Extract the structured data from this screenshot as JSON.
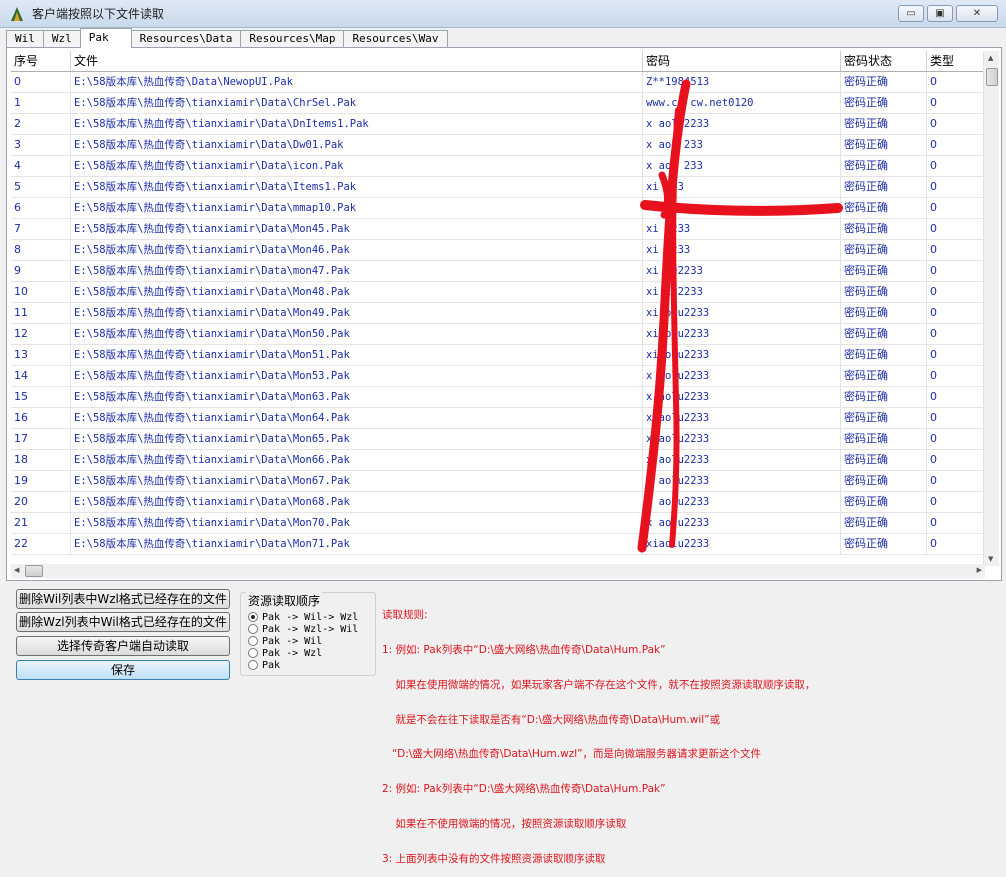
{
  "window": {
    "title": "客户端按照以下文件读取",
    "minimize_glyph": "▭",
    "maximize_glyph": "▣",
    "close_glyph": "✕"
  },
  "tabs": [
    {
      "label": "Wil"
    },
    {
      "label": "Wzl"
    },
    {
      "label": "Pak"
    },
    {
      "label": "Resources\\Data"
    },
    {
      "label": "Resources\\Map"
    },
    {
      "label": "Resources\\Wav"
    }
  ],
  "table": {
    "columns": {
      "index": "序号",
      "file": "文件",
      "password": "密码",
      "status": "密码状态",
      "type": "类型"
    },
    "rows": [
      {
        "index": "0",
        "file": "E:\\58版本库\\热血传奇\\Data\\NewopUI.Pak",
        "password": "Z**1984513",
        "status": "密码正确",
        "type": "0"
      },
      {
        "index": "1",
        "file": "E:\\58版本库\\热血传奇\\tianxiamir\\Data\\ChrSel.Pak",
        "password": "www.cc  cw.net0120",
        "status": "密码正确",
        "type": "0"
      },
      {
        "index": "2",
        "file": "E:\\58版本库\\热血传奇\\tianxiamir\\Data\\DnItems1.Pak",
        "password": "x  aolu2233",
        "status": "密码正确",
        "type": "0"
      },
      {
        "index": "3",
        "file": "E:\\58版本库\\热血传奇\\tianxiamir\\Data\\Dw01.Pak",
        "password": "x  aol  233",
        "status": "密码正确",
        "type": "0"
      },
      {
        "index": "4",
        "file": "E:\\58版本库\\热血传奇\\tianxiamir\\Data\\icon.Pak",
        "password": "x  aol  233",
        "status": "密码正确",
        "type": "0"
      },
      {
        "index": "5",
        "file": "E:\\58版本库\\热血传奇\\tianxiamir\\Data\\Items1.Pak",
        "password": "xi    233",
        "status": "密码正确",
        "type": "0"
      },
      {
        "index": "6",
        "file": "E:\\58版本库\\热血传奇\\tianxiamir\\Data\\mmap10.Pak",
        "password": "",
        "status": "密码正确",
        "type": "0"
      },
      {
        "index": "7",
        "file": "E:\\58版本库\\热血传奇\\tianxiamir\\Data\\Mon45.Pak",
        "password": "xi    2233",
        "status": "密码正确",
        "type": "0"
      },
      {
        "index": "8",
        "file": "E:\\58版本库\\热血传奇\\tianxiamir\\Data\\Mon46.Pak",
        "password": "xi    2233",
        "status": "密码正确",
        "type": "0"
      },
      {
        "index": "9",
        "file": "E:\\58版本库\\热血传奇\\tianxiamir\\Data\\mon47.Pak",
        "password": "xi   lu2233",
        "status": "密码正确",
        "type": "0"
      },
      {
        "index": "10",
        "file": "E:\\58版本库\\热血传奇\\tianxiamir\\Data\\Mon48.Pak",
        "password": "xi  lu2233",
        "status": "密码正确",
        "type": "0"
      },
      {
        "index": "11",
        "file": "E:\\58版本库\\热血传奇\\tianxiamir\\Data\\Mon49.Pak",
        "password": "xi  olu2233",
        "status": "密码正确",
        "type": "0"
      },
      {
        "index": "12",
        "file": "E:\\58版本库\\热血传奇\\tianxiamir\\Data\\Mon50.Pak",
        "password": "xi  olu2233",
        "status": "密码正确",
        "type": "0"
      },
      {
        "index": "13",
        "file": "E:\\58版本库\\热血传奇\\tianxiamir\\Data\\Mon51.Pak",
        "password": "xi  olu2233",
        "status": "密码正确",
        "type": "0"
      },
      {
        "index": "14",
        "file": "E:\\58版本库\\热血传奇\\tianxiamir\\Data\\Mon53.Pak",
        "password": "x  aolu2233",
        "status": "密码正确",
        "type": "0"
      },
      {
        "index": "15",
        "file": "E:\\58版本库\\热血传奇\\tianxiamir\\Data\\Mon63.Pak",
        "password": "x  aolu2233",
        "status": "密码正确",
        "type": "0"
      },
      {
        "index": "16",
        "file": "E:\\58版本库\\热血传奇\\tianxiamir\\Data\\Mon64.Pak",
        "password": "x  aolu2233",
        "status": "密码正确",
        "type": "0"
      },
      {
        "index": "17",
        "file": "E:\\58版本库\\热血传奇\\tianxiamir\\Data\\Mon65.Pak",
        "password": "x  aolu2233",
        "status": "密码正确",
        "type": "0"
      },
      {
        "index": "18",
        "file": "E:\\58版本库\\热血传奇\\tianxiamir\\Data\\Mon66.Pak",
        "password": "x  aolu2233",
        "status": "密码正确",
        "type": "0"
      },
      {
        "index": "19",
        "file": "E:\\58版本库\\热血传奇\\tianxiamir\\Data\\Mon67.Pak",
        "password": "x  aolu2233",
        "status": "密码正确",
        "type": "0"
      },
      {
        "index": "20",
        "file": "E:\\58版本库\\热血传奇\\tianxiamir\\Data\\Mon68.Pak",
        "password": "x  aolu2233",
        "status": "密码正确",
        "type": "0"
      },
      {
        "index": "21",
        "file": "E:\\58版本库\\热血传奇\\tianxiamir\\Data\\Mon70.Pak",
        "password": "x  aolu2233",
        "status": "密码正确",
        "type": "0"
      },
      {
        "index": "22",
        "file": "E:\\58版本库\\热血传奇\\tianxiamir\\Data\\Mon71.Pak",
        "password": "xiaolu2233",
        "status": "密码正确",
        "type": "0"
      }
    ]
  },
  "scrollbar": {
    "up": "▲",
    "down": "▼",
    "left": "◀",
    "right": "▶"
  },
  "buttons": {
    "delete_wzl": "删除Wil列表中Wzl格式已经存在的文件",
    "delete_wil": "删除Wzl列表中Wil格式已经存在的文件",
    "auto_read": "选择传奇客户端自动读取",
    "save": "保存"
  },
  "read_order": {
    "title": "资源读取顺序",
    "selected": 0,
    "options": [
      "Pak -> Wil-> Wzl",
      "Pak -> Wzl-> Wil",
      "Pak -> Wil",
      "Pak -> Wzl",
      "Pak"
    ]
  },
  "rules": {
    "title": "读取规则:",
    "lines": [
      "1: 例如: Pak列表中“D:\\盛大网络\\热血传奇\\Data\\Hum.Pak”",
      "    如果在使用微端的情况，如果玩家客户端不存在这个文件，就不在按照资源读取顺序读取，",
      "    就是不会在往下读取是否有“D:\\盛大网络\\热血传奇\\Data\\Hum.wil”或",
      "   “D:\\盛大网络\\热血传奇\\Data\\Hum.wzl”，而是向微端服务器请求更新这个文件",
      "2: 例如: Pak列表中“D:\\盛大网络\\热血传奇\\Data\\Hum.Pak”",
      "    如果在不使用微端的情况，按照资源读取顺序读取",
      "3: 上面列表中没有的文件按照资源读取顺序读取"
    ]
  },
  "colors": {
    "scribble": "#e8121e",
    "link_text": "#1c2fa8",
    "rules_text": "#e0141e"
  }
}
